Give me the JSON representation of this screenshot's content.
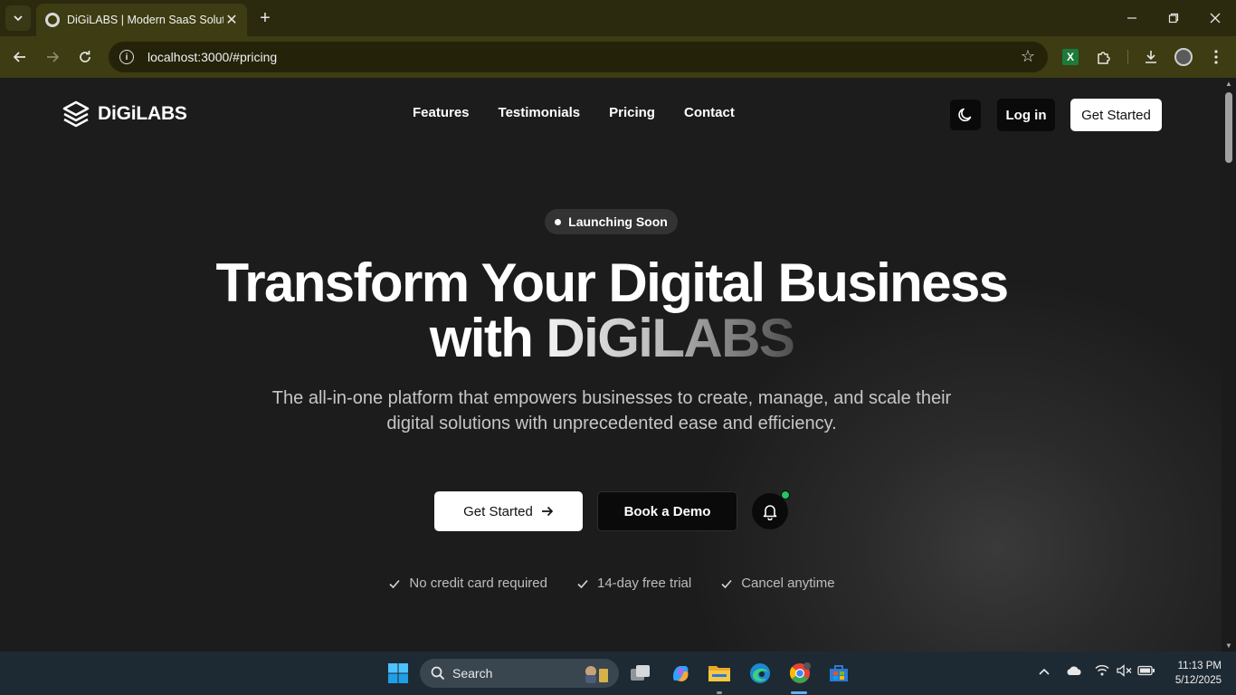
{
  "browser": {
    "tab_title": "DiGiLABS | Modern SaaS Solutions",
    "url": "localhost:3000/#pricing"
  },
  "site": {
    "logo_text": "DiGiLABS",
    "nav": [
      "Features",
      "Testimonials",
      "Pricing",
      "Contact"
    ],
    "login_label": "Log in",
    "nav_cta_label": "Get Started"
  },
  "hero": {
    "badge": "Launching Soon",
    "title_line1": "Transform Your Digital Business",
    "title_with": "with",
    "title_brand": "DiGiLABS",
    "subtitle": "The all-in-one platform that empowers businesses to create, manage, and scale their digital solutions with unprecedented ease and efficiency.",
    "cta_primary": "Get Started",
    "cta_secondary": "Book a Demo",
    "perks": [
      "No credit card required",
      "14-day free trial",
      "Cancel anytime"
    ]
  },
  "taskbar": {
    "search_label": "Search",
    "time": "11:13 PM",
    "date": "5/12/2025"
  },
  "colors": {
    "accent_green": "#22c55e",
    "page_bg": "#1c1c1c",
    "chrome_bg": "#3d3c12"
  }
}
